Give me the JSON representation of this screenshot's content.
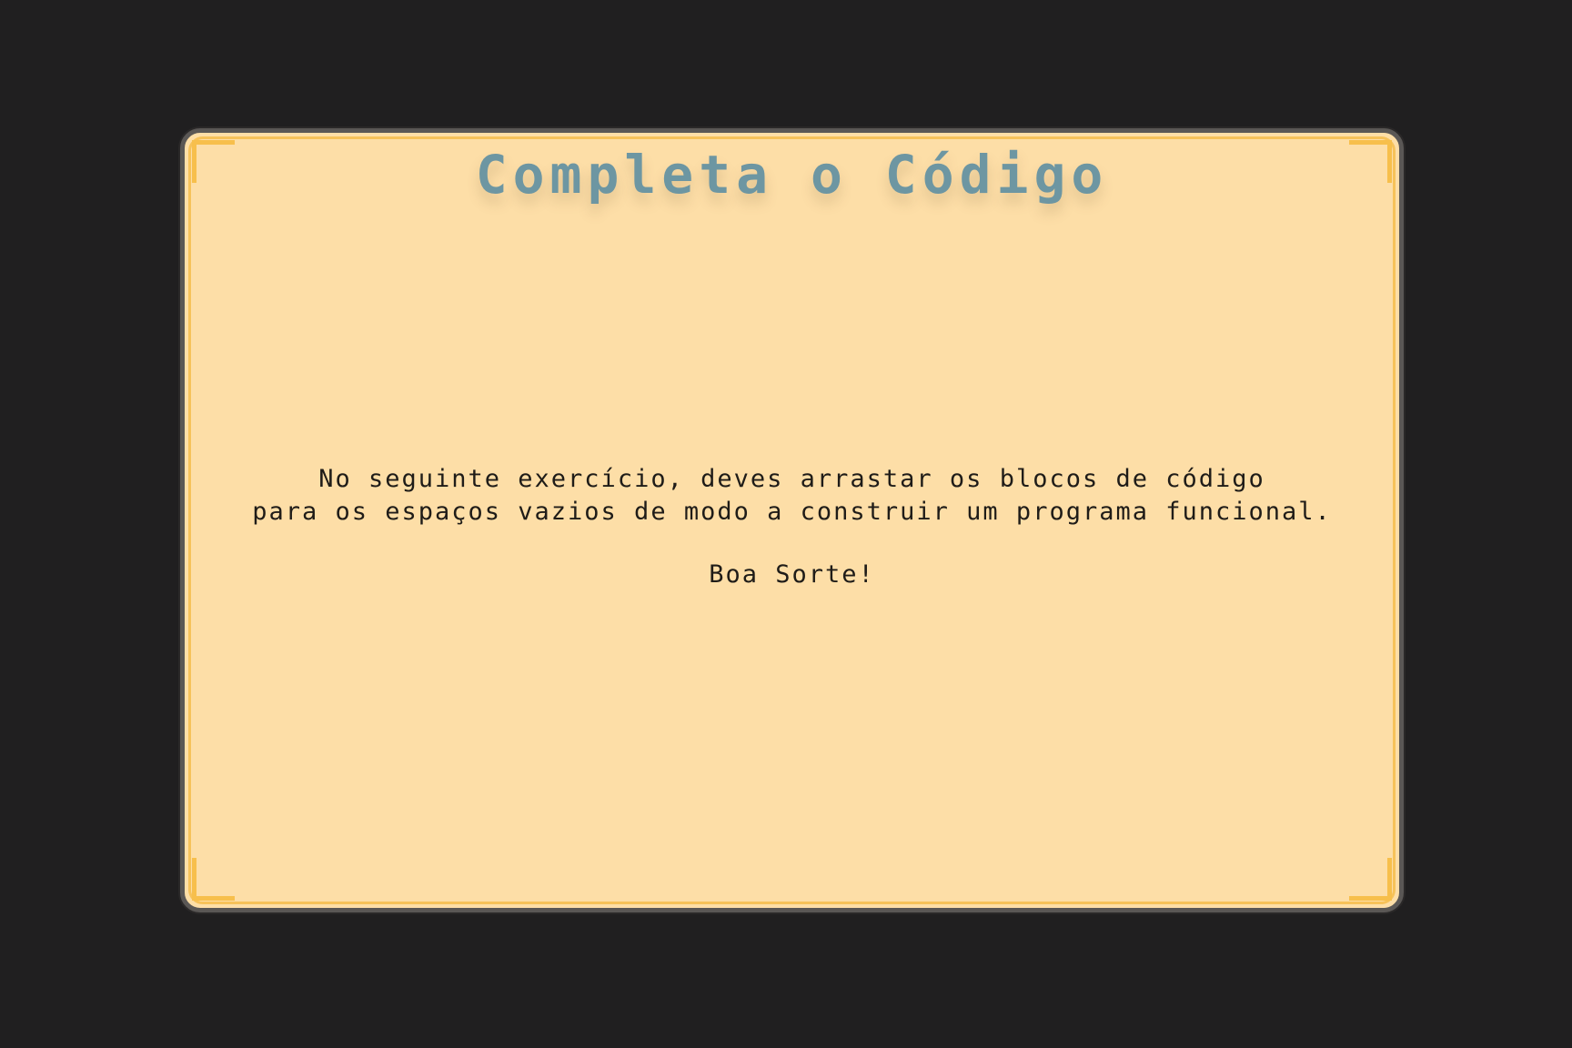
{
  "dialog": {
    "title": "Completa o Código",
    "instructions_line1": "No seguinte exercício, deves arrastar os blocos de código",
    "instructions_line2": "para os espaços vazios de modo a construir um programa funcional.",
    "good_luck": "Boa Sorte!"
  },
  "colors": {
    "background": "#201f20",
    "panel": "#fddea7",
    "panel_border": "#5a5755",
    "accent_border": "#f6c25a",
    "title": "#6d96a2",
    "text": "#1f1c18"
  }
}
